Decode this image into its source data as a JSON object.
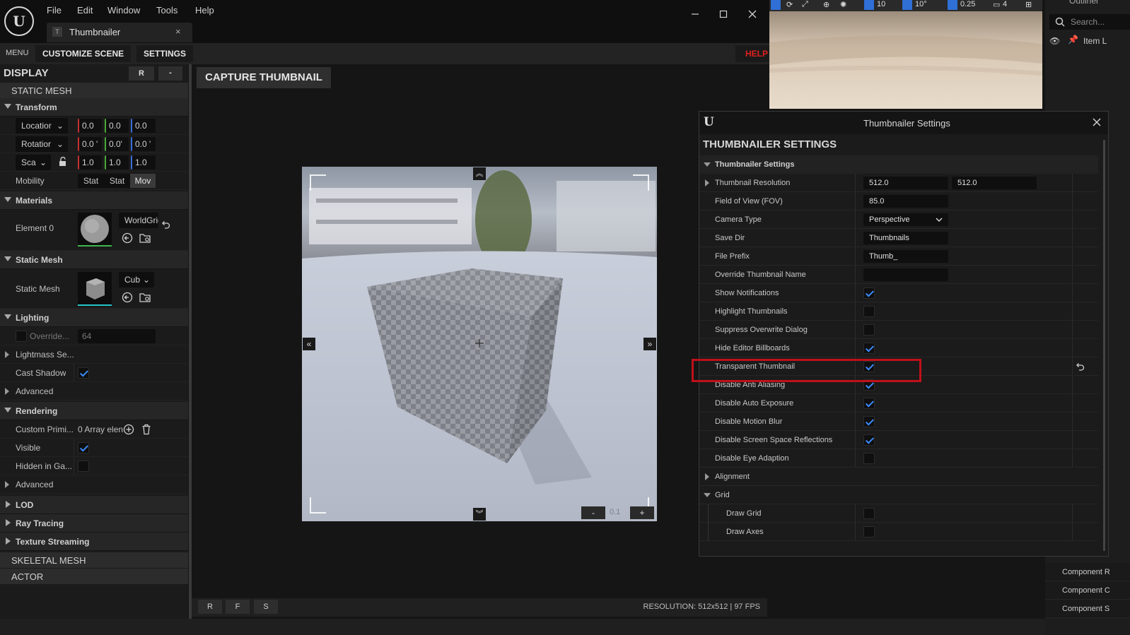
{
  "app": {
    "menu": [
      "File",
      "Edit",
      "Window",
      "Tools",
      "Help"
    ],
    "tab_icon": "T",
    "tab_title": "Thumbnailer",
    "tab_close": "×"
  },
  "toolbar": {
    "menu": "MENU",
    "customize": "CUSTOMIZE SCENE",
    "settings": "SETTINGS",
    "help": "HELP"
  },
  "left": {
    "title": "DISPLAY",
    "btn_r": "R",
    "btn_minus": "-",
    "static_mesh": "STATIC MESH",
    "transform": "Transform",
    "location": {
      "label": "Locatior",
      "x": "0.0",
      "y": "0.0",
      "z": "0.0"
    },
    "rotation": {
      "label": "Rotatior",
      "x": "0.0 '",
      "y": "0.0'",
      "z": "0.0 '"
    },
    "scale": {
      "label": "Sca",
      "x": "1.0",
      "y": "1.0",
      "z": "1.0"
    },
    "mobility": {
      "label": "Mobility",
      "opts": [
        "Stat",
        "Stat",
        "Mov"
      ]
    },
    "materials": "Materials",
    "element0": "Element 0",
    "material_name": "WorldGrid",
    "static_mesh_sec": "Static Mesh",
    "static_mesh_label": "Static Mesh",
    "mesh_name": "Cub",
    "lighting": "Lighting",
    "override": "Override...",
    "override_val": "64",
    "lightmass": "Lightmass Se...",
    "cast_shadow": "Cast Shadow",
    "advanced1": "Advanced",
    "rendering": "Rendering",
    "custom_prim": "Custom Primi...",
    "array_text": "0 Array elen",
    "visible": "Visible",
    "hidden": "Hidden in Ga...",
    "advanced2": "Advanced",
    "lod": "LOD",
    "ray_tracing": "Ray Tracing",
    "texture_streaming": "Texture Streaming",
    "skeletal_mesh": "SKELETAL MESH",
    "actor": "ACTOR"
  },
  "viewport": {
    "capture": "CAPTURE THUMBNAIL",
    "zoom_minus": "-",
    "zoom_value": "0.1",
    "zoom_plus": "+",
    "btn_r": "R",
    "btn_f": "F",
    "btn_s": "S",
    "resolution": "RESOLUTION: 512x512 | 97 FPS"
  },
  "top_right": {
    "tool_values": [
      "10",
      "10°",
      "0.25",
      "4"
    ],
    "outliner": "Outliner",
    "search": "Search...",
    "item_label": "Item L",
    "components": [
      "Component R",
      "Component C",
      "Component S"
    ]
  },
  "settings": {
    "window_title": "Thumbnailer Settings",
    "heading": "THUMBNAILER SETTINGS",
    "group": "Thumbnailer Settings",
    "resolution": {
      "label": "Thumbnail Resolution",
      "x": "512.0",
      "y": "512.0"
    },
    "fov": {
      "label": "Field of View (FOV)",
      "value": "85.0"
    },
    "camera": {
      "label": "Camera Type",
      "value": "Perspective"
    },
    "save_dir": {
      "label": "Save Dir",
      "value": "Thumbnails"
    },
    "prefix": {
      "label": "File Prefix",
      "value": "Thumb_"
    },
    "override_name": {
      "label": "Override Thumbnail Name",
      "value": ""
    },
    "checks": [
      {
        "label": "Show Notifications",
        "on": true
      },
      {
        "label": "Highlight Thumbnails",
        "on": false
      },
      {
        "label": "Suppress Overwrite Dialog",
        "on": false
      },
      {
        "label": "Hide Editor Billboards",
        "on": true
      },
      {
        "label": "Transparent Thumbnail",
        "on": true
      },
      {
        "label": "Disable Anti Aliasing",
        "on": true
      },
      {
        "label": "Disable Auto Exposure",
        "on": true
      },
      {
        "label": "Disable Motion Blur",
        "on": true
      },
      {
        "label": "Disable Screen Space Reflections",
        "on": true
      },
      {
        "label": "Disable Eye Adaption",
        "on": false
      }
    ],
    "alignment": "Alignment",
    "grid": "Grid",
    "draw_grid": "Draw Grid",
    "draw_axes": "Draw Axes"
  },
  "colors": {
    "highlight": "#c0101a",
    "accent": "#3b8cff",
    "help": "#e02020"
  }
}
